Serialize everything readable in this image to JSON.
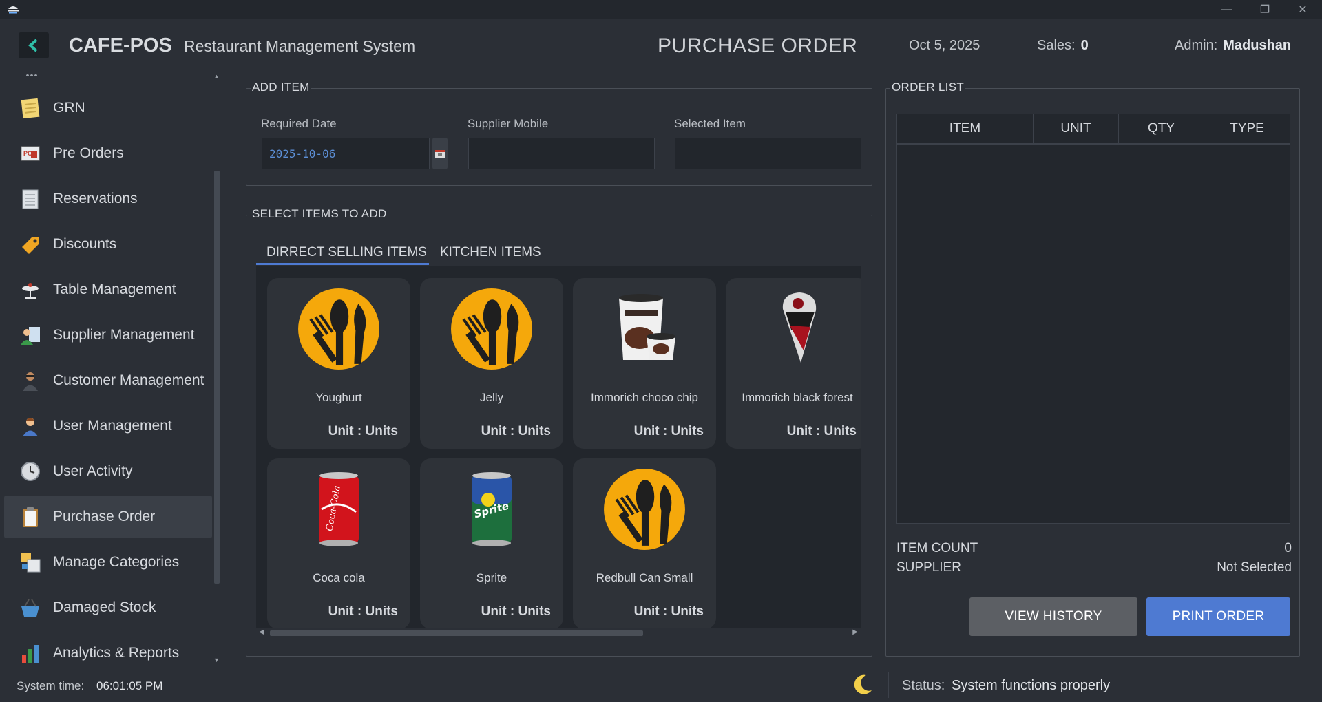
{
  "header": {
    "brand": "CAFE-POS",
    "subtitle": "Restaurant Management System",
    "page_title": "PURCHASE ORDER",
    "date": "Oct 5, 2025",
    "sales_label": "Sales:",
    "sales_value": "0",
    "admin_label": "Admin:",
    "admin_value": "Madushan"
  },
  "sidebar": {
    "items": [
      {
        "label": "GRN",
        "icon": "notepad-icon"
      },
      {
        "label": "Pre Orders",
        "icon": "pre-order-icon"
      },
      {
        "label": "Reservations",
        "icon": "calendar-sheet-icon"
      },
      {
        "label": "Discounts",
        "icon": "tag-icon"
      },
      {
        "label": "Table Management",
        "icon": "table-icon"
      },
      {
        "label": "Supplier Management",
        "icon": "supplier-icon"
      },
      {
        "label": "Customer Management",
        "icon": "customer-icon"
      },
      {
        "label": "User Management",
        "icon": "user-icon"
      },
      {
        "label": "User Activity",
        "icon": "clock-icon"
      },
      {
        "label": "Purchase Order",
        "icon": "clipboard-icon",
        "active": true
      },
      {
        "label": "Manage Categories",
        "icon": "categories-icon"
      },
      {
        "label": "Damaged Stock",
        "icon": "basket-icon"
      },
      {
        "label": "Analytics & Reports",
        "icon": "bar-chart-icon"
      }
    ]
  },
  "add_item": {
    "legend": "ADD ITEM",
    "required_date_label": "Required Date",
    "required_date_value": "2025-10-06",
    "supplier_mobile_label": "Supplier Mobile",
    "supplier_mobile_value": "",
    "selected_item_label": "Selected Item",
    "selected_item_value": ""
  },
  "select_items": {
    "legend": "SELECT ITEMS TO ADD",
    "tabs": [
      "DIRRECT SELLING ITEMS",
      "KITCHEN ITEMS"
    ],
    "active_tab": 0,
    "items": [
      {
        "name": "Youghurt",
        "unit": "Unit : Units",
        "image": "cutlery-logo-icon"
      },
      {
        "name": "Jelly",
        "unit": "Unit : Units",
        "image": "cutlery-logo-icon"
      },
      {
        "name": "Immorich choco chip",
        "unit": "Unit : Units",
        "image": "ice-cream-tub-image"
      },
      {
        "name": "Immorich black forest",
        "unit": "Unit : Units",
        "image": "ice-cream-cone-image"
      },
      {
        "name": "Coca cola",
        "unit": "Unit : Units",
        "image": "coca-cola-can-image"
      },
      {
        "name": "Sprite",
        "unit": "Unit : Units",
        "image": "sprite-can-image"
      },
      {
        "name": "Redbull Can Small",
        "unit": "Unit : Units",
        "image": "cutlery-logo-icon"
      }
    ]
  },
  "order_list": {
    "legend": "ORDER LIST",
    "columns": [
      "ITEM",
      "UNIT",
      "QTY",
      "TYPE"
    ],
    "rows": [],
    "item_count_label": "ITEM COUNT",
    "item_count_value": "0",
    "supplier_label": "SUPPLIER",
    "supplier_value": "Not Selected",
    "view_history_label": "VIEW HISTORY",
    "print_order_label": "PRINT ORDER"
  },
  "status_bar": {
    "time_label": "System time:",
    "time_value": "06:01:05 PM",
    "status_label": "Status:",
    "status_value": "System functions properly"
  },
  "colors": {
    "accent": "#4e7ad2",
    "brand_orange": "#f5a80b",
    "back_arrow": "#2fbfa8",
    "button_grey": "#5c5f64"
  }
}
